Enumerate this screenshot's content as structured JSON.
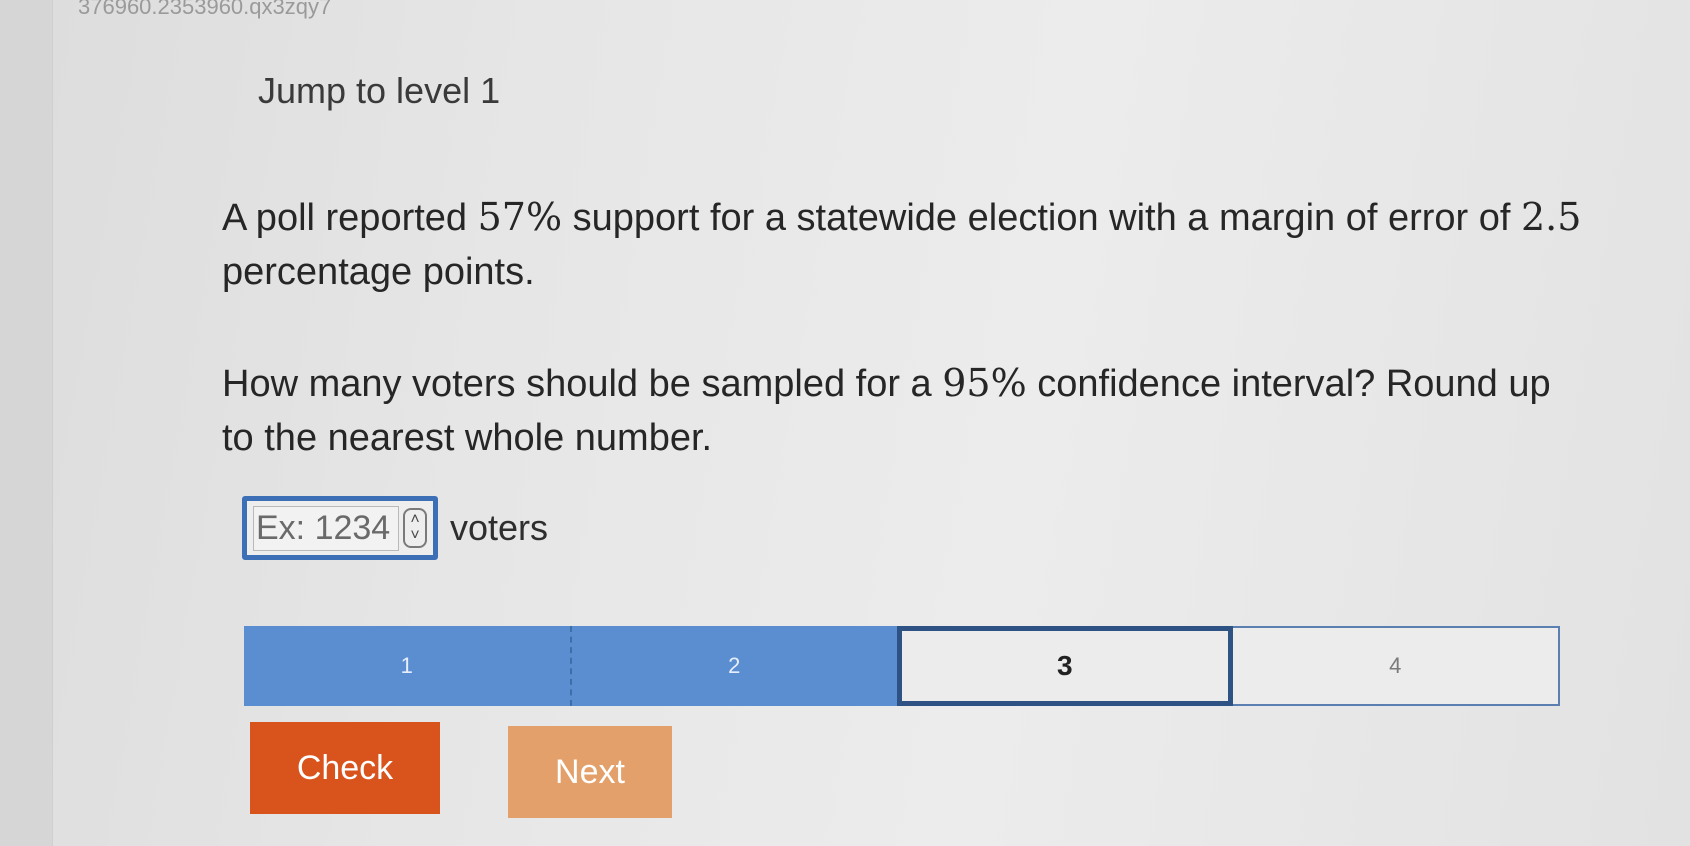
{
  "activity_id": "376960.2353960.qx3zqy7",
  "jump_link": "Jump to level 1",
  "question": {
    "p1_a": "A poll reported ",
    "p1_support": "57%",
    "p1_b": " support for a statewide election with a margin of error of ",
    "p1_margin": "2.5",
    "p1_c": " percentage points.",
    "p2_a": "How many voters should be sampled for a ",
    "p2_confidence": "95%",
    "p2_b": " confidence interval? Round up to the nearest whole number."
  },
  "answer": {
    "placeholder": "Ex: 1234",
    "value": "",
    "unit": "voters",
    "spinner_up": "˄",
    "spinner_down": "˅"
  },
  "levels": [
    {
      "label": "1",
      "state": "done"
    },
    {
      "label": "2",
      "state": "done"
    },
    {
      "label": "3",
      "state": "current"
    },
    {
      "label": "4",
      "state": "future"
    }
  ],
  "buttons": {
    "check": "Check",
    "next": "Next"
  },
  "colors": {
    "level_done": "#5b8ed0",
    "level_current_border": "#2f5284",
    "check_button": "#d9531c",
    "next_button": "#e3a06a",
    "input_focus_border": "#3c6fb6"
  }
}
